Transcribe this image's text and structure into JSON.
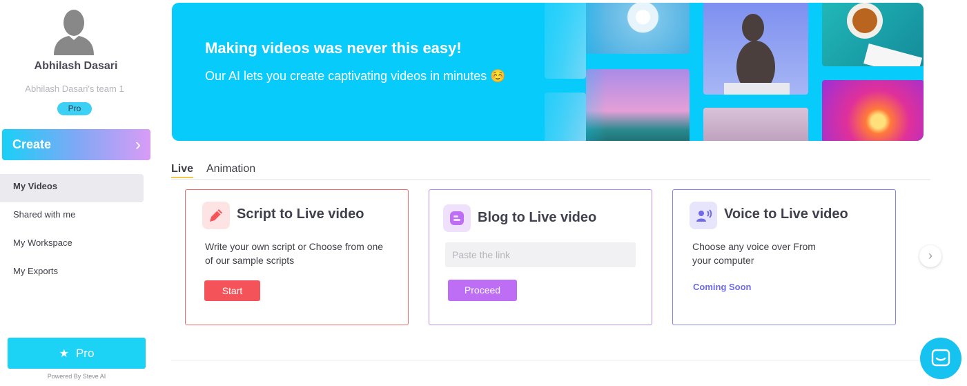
{
  "user": {
    "name": "Abhilash Dasari",
    "team": "Abhilash Dasari's team 1",
    "plan_badge": "Pro"
  },
  "sidebar": {
    "create_label": "Create",
    "items": [
      {
        "label": "My Videos",
        "active": true
      },
      {
        "label": "Shared with me",
        "active": false
      },
      {
        "label": "My Workspace",
        "active": false
      },
      {
        "label": "My Exports",
        "active": false
      }
    ],
    "pro_button_label": "Pro",
    "powered_by": "Powered By Steve AI"
  },
  "banner": {
    "title": "Making videos was never this easy!",
    "subtitle": "Our AI lets you create captivating videos in minutes ☺️"
  },
  "tabs": [
    {
      "label": "Live",
      "active": true
    },
    {
      "label": "Animation",
      "active": false
    }
  ],
  "cards": {
    "script": {
      "title": "Script to Live video",
      "description": "Write your own script or Choose from one of our sample scripts",
      "button": "Start"
    },
    "blog": {
      "title": "Blog to Live video",
      "input_placeholder": "Paste the link",
      "button": "Proceed"
    },
    "voice": {
      "title": "Voice to Live video",
      "description": "Choose any voice over From your computer",
      "status": "Coming Soon"
    }
  },
  "colors": {
    "brand_cyan": "#07ccfb",
    "script_accent": "#f4535a",
    "blog_accent": "#be6ef5",
    "voice_accent": "#6e6ae8"
  }
}
